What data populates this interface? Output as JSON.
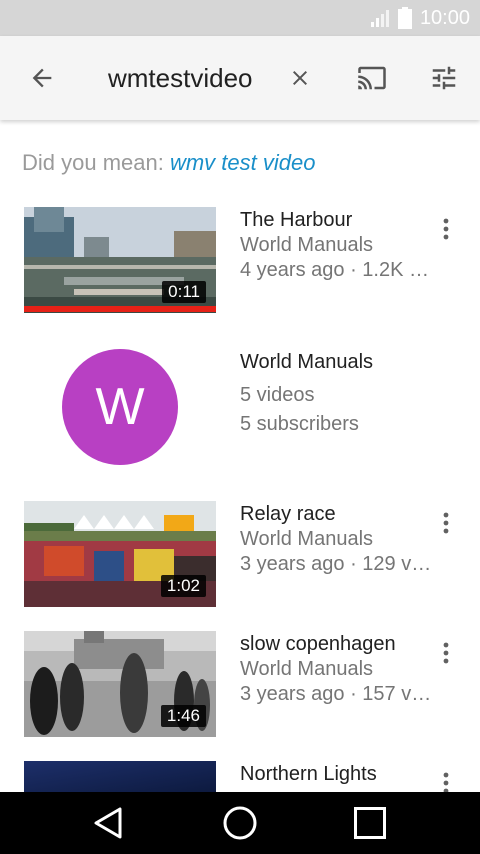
{
  "status": {
    "time": "10:00"
  },
  "search": {
    "query": "wmtestvideo"
  },
  "suggestion": {
    "prefix": "Did you mean: ",
    "text": "wmv test video"
  },
  "results": [
    {
      "title": "The Harbour",
      "channel": "World Manuals",
      "meta": "4 years ago · 1.2K views",
      "duration": "0:11"
    },
    {
      "title": "Relay race",
      "channel": "World Manuals",
      "meta": "3 years ago · 129 views",
      "duration": "1:02"
    },
    {
      "title": "slow copenhagen",
      "channel": "World Manuals",
      "meta": "3 years ago · 157 views",
      "duration": "1:46"
    },
    {
      "title": "Northern Lights"
    }
  ],
  "channel_result": {
    "avatar_letter": "W",
    "name": "World Manuals",
    "videos": "5 videos",
    "subscribers": "5 subscribers",
    "avatar_color": "#b840c3"
  },
  "colors": {
    "accent": "#1a8fc9",
    "progress_red": "#e62117"
  }
}
